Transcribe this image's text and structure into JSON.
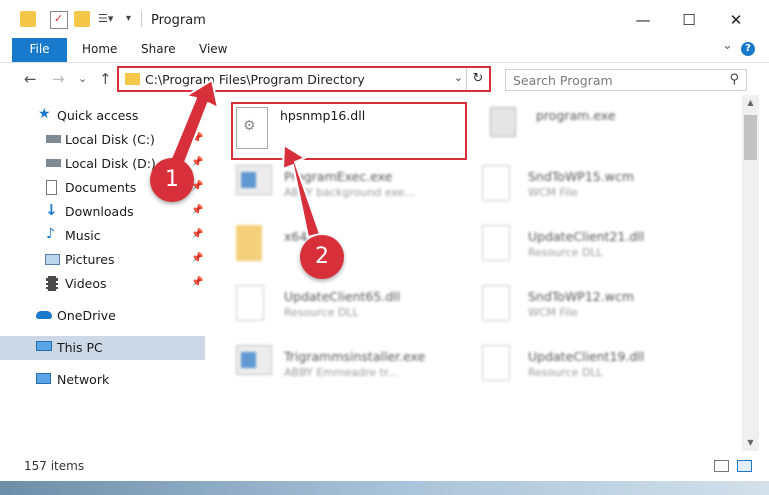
{
  "window": {
    "title": "Program",
    "minimize": "—",
    "maximize": "☐",
    "close": "✕"
  },
  "ribbon": {
    "file": "File",
    "home": "Home",
    "share": "Share",
    "view": "View",
    "expand": "⌄",
    "help": "?"
  },
  "address": {
    "path": "C:\\Program Files\\Program Directory",
    "dropdown": "⌄",
    "refresh": "↻"
  },
  "search": {
    "placeholder": "Search Program",
    "icon": "⚲"
  },
  "nav": {
    "back": "←",
    "forward": "→",
    "recent": "⌄",
    "up": "↑",
    "items": [
      {
        "label": "Quick access"
      },
      {
        "label": "Local Disk (C:)"
      },
      {
        "label": "Local Disk (D:)"
      },
      {
        "label": "Documents"
      },
      {
        "label": "Downloads"
      },
      {
        "label": "Music"
      },
      {
        "label": "Pictures"
      },
      {
        "label": "Videos"
      },
      {
        "label": "OneDrive"
      },
      {
        "label": "This PC"
      },
      {
        "label": "Network"
      }
    ],
    "pin": "📌"
  },
  "files": [
    {
      "name": "hpsnmp16.dll",
      "sub": ""
    },
    {
      "name": "program.exe",
      "sub": ""
    },
    {
      "name": "ProgramExec.exe",
      "sub": "ABBY background exe..."
    },
    {
      "name": "SndToWP15.wcm",
      "sub": "WCM File"
    },
    {
      "name": "x64",
      "sub": ""
    },
    {
      "name": "UpdateClient21.dll",
      "sub": "Resource DLL"
    },
    {
      "name": "UpdateClient65.dll",
      "sub": "Resource DLL"
    },
    {
      "name": "SndToWP12.wcm",
      "sub": "WCM File"
    },
    {
      "name": "Trigrammsinstaller.exe",
      "sub": "ABBY Emmeadre tr..."
    },
    {
      "name": "UpdateClient19.dll",
      "sub": "Resource DLL"
    }
  ],
  "status": {
    "count": "157 items"
  },
  "annotations": {
    "step1": "1",
    "step2": "2"
  },
  "colors": {
    "accent": "#1979ca",
    "highlight": "#d8303b",
    "selected": "#ccd8e6"
  }
}
